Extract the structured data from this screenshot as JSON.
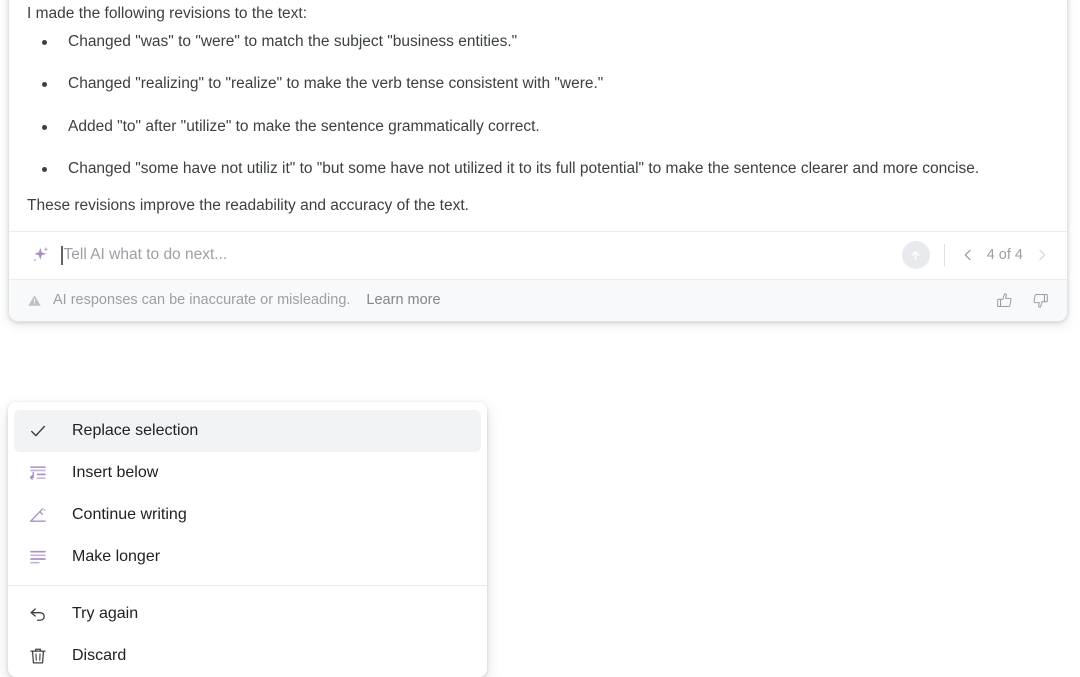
{
  "response": {
    "lead": "I made the following revisions to the text:",
    "bullets": [
      "Changed \"was\" to \"were\" to match the subject \"business entities.\"",
      "Changed \"realizing\" to \"realize\" to make the verb tense consistent with \"were.\"",
      "Added \"to\" after \"utilize\" to make the sentence grammatically correct.",
      "Changed \"some have not utiliz it\" to \"but some have not utilized it to its full potential\" to make the sentence clearer and more concise."
    ],
    "tail": "These revisions improve the readability and accuracy of the text."
  },
  "prompt": {
    "placeholder": "Tell AI what to do next...",
    "value": "",
    "sparkle_icon": "sparkle-icon",
    "send_icon": "arrow-up-circle-icon"
  },
  "pagination": {
    "prev_icon": "chevron-left-icon",
    "next_icon": "chevron-right-icon",
    "label": "4 of 4",
    "current": 4,
    "total": 4
  },
  "disclaimer": {
    "warning_icon": "warning-triangle-icon",
    "text": "AI responses can be inaccurate or misleading.",
    "learn_more": "Learn more",
    "thumbs_up_icon": "thumbs-up-icon",
    "thumbs_down_icon": "thumbs-down-icon"
  },
  "menu": {
    "items": [
      {
        "label": "Replace selection",
        "icon": "check-icon",
        "selected": true,
        "accent": false
      },
      {
        "label": "Insert below",
        "icon": "insert-below-icon",
        "selected": false,
        "accent": true
      },
      {
        "label": "Continue writing",
        "icon": "pencil-line-icon",
        "selected": false,
        "accent": true
      },
      {
        "label": "Make longer",
        "icon": "text-lines-icon",
        "selected": false,
        "accent": true
      }
    ],
    "items_secondary": [
      {
        "label": "Try again",
        "icon": "undo-arrow-icon",
        "selected": false,
        "accent": false
      },
      {
        "label": "Discard",
        "icon": "trash-icon",
        "selected": false,
        "accent": false
      }
    ]
  },
  "colors": {
    "accent_purple": "#a98fc4",
    "text_primary": "#202124",
    "text_body": "#3c4043",
    "text_muted": "#9aa0a6",
    "surface": "#ffffff",
    "surface_alt": "#f8f9fa",
    "selected_row": "#f1f3f4"
  }
}
